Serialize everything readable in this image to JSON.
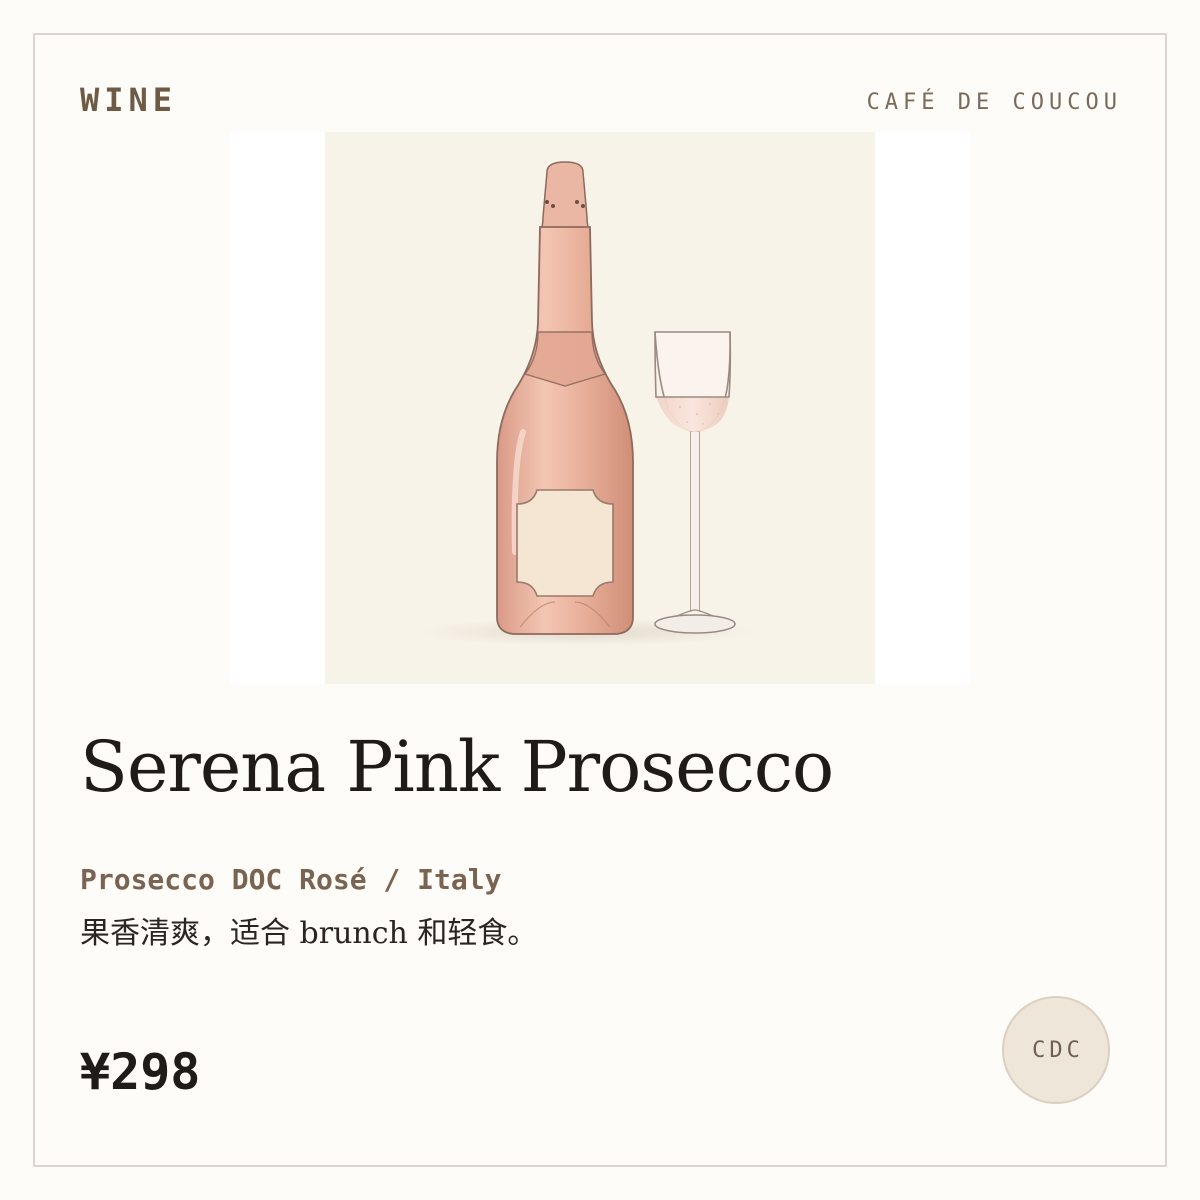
{
  "header": {
    "category": "WINE",
    "brand": "CAFÉ DE COUCOU"
  },
  "illustration": {
    "icon": "rose-prosecco-bottle-and-flute-illustration"
  },
  "product": {
    "name": "Serena Pink Prosecco",
    "origin": "Prosecco DOC Rosé / Italy",
    "description": "果香清爽，适合 brunch 和轻食。",
    "price": "¥298"
  },
  "badge": {
    "text": "CDC"
  },
  "colors": {
    "background": "#fdfcf8",
    "border": "#d9d6d0",
    "accent_brown": "#6f5a45",
    "rose": "#e8b4a0",
    "badge_fill": "#efe6da"
  }
}
